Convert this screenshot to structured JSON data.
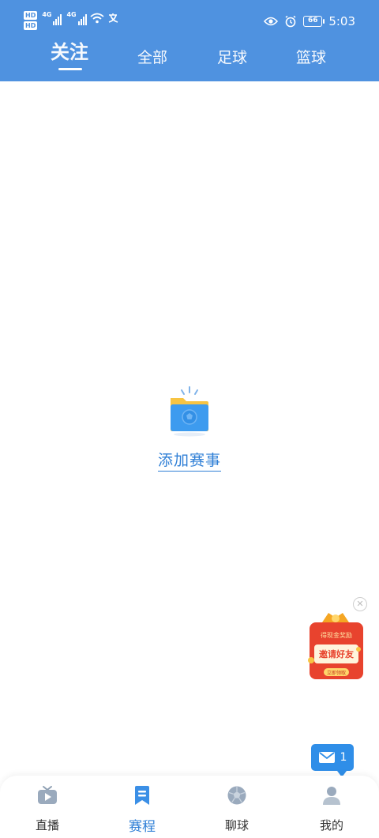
{
  "status_bar": {
    "hd1": "HD",
    "hd2": "HD",
    "sig1": "4G",
    "sig2": "4G",
    "battery": "66",
    "time": "5:03"
  },
  "tabs": [
    {
      "label": "关注",
      "active": true
    },
    {
      "label": "全部",
      "active": false
    },
    {
      "label": "足球",
      "active": false
    },
    {
      "label": "篮球",
      "active": false
    }
  ],
  "empty_state": {
    "action_label": "添加赛事",
    "icon": "folder-football-icon"
  },
  "promo": {
    "top_text": "得现金奖励",
    "main_text": "邀请好友",
    "button_text": "立即领取",
    "close_icon": "close-icon"
  },
  "message": {
    "count": "1",
    "icon": "mail-icon"
  },
  "bottom_nav": [
    {
      "label": "直播",
      "icon": "tv-icon",
      "active": false
    },
    {
      "label": "赛程",
      "icon": "bookmark-schedule-icon",
      "active": true
    },
    {
      "label": "聊球",
      "icon": "football-icon",
      "active": false
    },
    {
      "label": "我的",
      "icon": "user-icon",
      "active": false
    }
  ],
  "colors": {
    "header": "#4f92e0",
    "accent": "#2f7fd6",
    "promo_red": "#e8432e"
  }
}
